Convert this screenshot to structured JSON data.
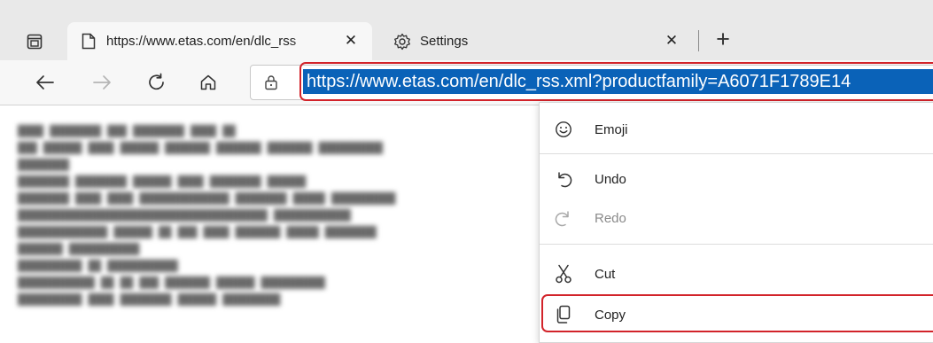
{
  "tabs": [
    {
      "title": "https://www.etas.com/en/dlc_rss",
      "close": "✕",
      "active": true
    },
    {
      "title": "Settings",
      "close": "✕",
      "active": false
    }
  ],
  "new_tab_label": "+",
  "address_bar": {
    "url": "https://www.etas.com/en/dlc_rss.xml?productfamily=A6071F1789E14"
  },
  "context_menu": {
    "items": [
      {
        "label": "Emoji",
        "icon": "emoji-icon",
        "enabled": true
      },
      {
        "label": "Undo",
        "icon": "undo-icon",
        "enabled": true
      },
      {
        "label": "Redo",
        "icon": "redo-icon",
        "enabled": false
      },
      {
        "label": "Cut",
        "icon": "cut-icon",
        "enabled": true
      },
      {
        "label": "Copy",
        "icon": "copy-icon",
        "enabled": true
      }
    ]
  },
  "colors": {
    "selection": "#0a62b8",
    "highlight_outline": "#d2232a",
    "tabstrip": "#e9e9e9",
    "toolbar": "#f7f7f7"
  }
}
